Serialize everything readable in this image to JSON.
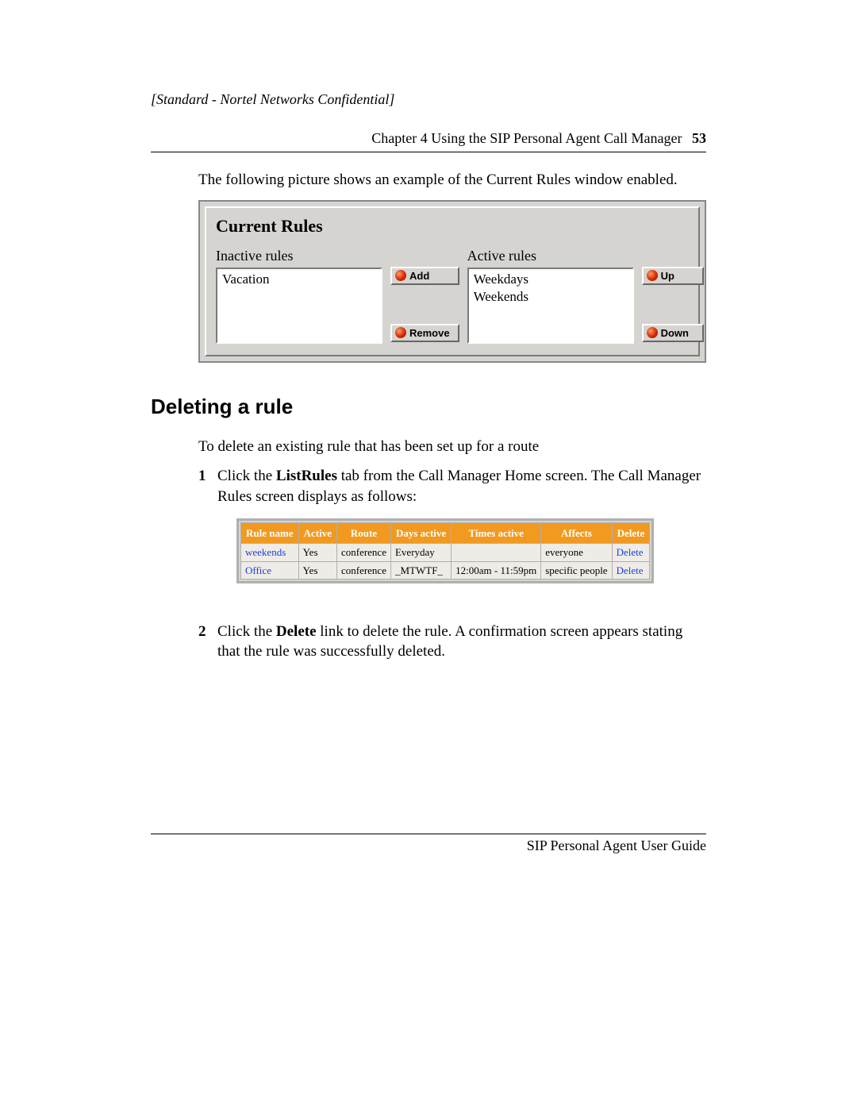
{
  "header": {
    "confidential": "[Standard - Nortel Networks Confidential]",
    "chapter_line": "Chapter 4  Using the SIP Personal Agent Call Manager",
    "page_number": "53"
  },
  "intro_text": "The following picture shows an example of the Current Rules window enabled.",
  "current_rules_panel": {
    "title": "Current Rules",
    "inactive_label": "Inactive rules",
    "active_label": "Active rules",
    "inactive_items": [
      "Vacation"
    ],
    "active_items": [
      "Weekdays",
      "Weekends"
    ],
    "buttons": {
      "add": "Add",
      "remove": "Remove",
      "up": "Up",
      "down": "Down"
    }
  },
  "section_heading": "Deleting a rule",
  "delete_intro": "To delete an existing rule that has been set up for a route",
  "step1": {
    "pre": "Click the ",
    "bold": "ListRules",
    "post": " tab from the Call Manager Home screen. The Call Manager Rules screen displays as follows:"
  },
  "rules_table": {
    "headers": {
      "rule_name": "Rule name",
      "active": "Active",
      "route": "Route",
      "days_active": "Days active",
      "times_active": "Times active",
      "affects": "Affects",
      "delete": "Delete"
    },
    "rows": [
      {
        "rule_name": "weekends",
        "active": "Yes",
        "route": "conference",
        "days_active": "Everyday",
        "times_active": "",
        "affects": "everyone",
        "delete": "Delete"
      },
      {
        "rule_name": "Office",
        "active": "Yes",
        "route": "conference",
        "days_active": "_MTWTF_",
        "times_active": "12:00am - 11:59pm",
        "affects": "specific people",
        "delete": "Delete"
      }
    ]
  },
  "step2": {
    "pre": "Click the ",
    "bold": "Delete",
    "post": " link to delete the rule. A confirmation screen appears stating that the rule was successfully deleted."
  },
  "footer": {
    "guide": "SIP Personal Agent User Guide"
  }
}
